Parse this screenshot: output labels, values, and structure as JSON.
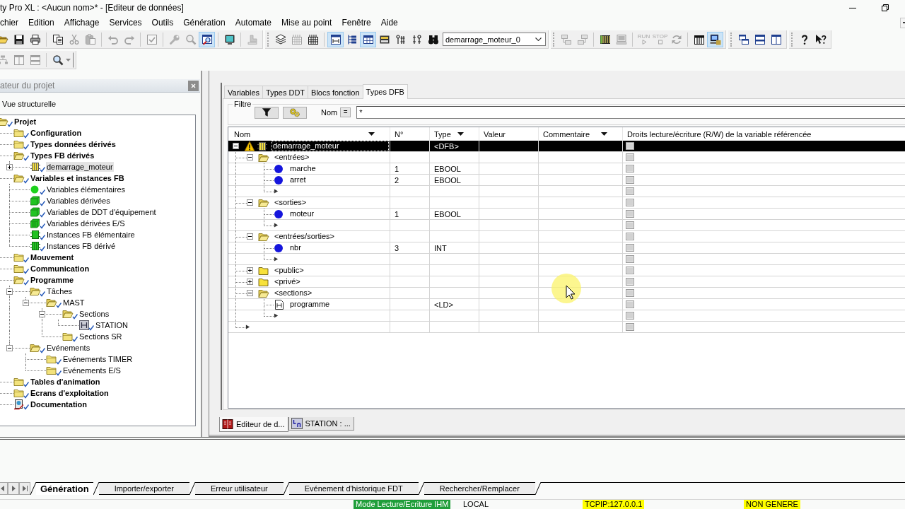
{
  "window": {
    "title": "ty Pro XL : <Aucun nom>* - [Editeur de données]"
  },
  "menu": [
    "chier",
    "Edition",
    "Affichage",
    "Services",
    "Outils",
    "Génération",
    "Automate",
    "Mise au point",
    "Fenêtre",
    "Aide"
  ],
  "toolbar_rows": [
    [
      [
        [
          {
            "kind": "open",
            "pressed": false,
            "disabled": false
          },
          {
            "kind": "save",
            "pressed": false,
            "disabled": false
          },
          {
            "kind": "print",
            "pressed": false,
            "disabled": false
          }
        ],
        [
          {
            "kind": "copy",
            "pressed": false,
            "disabled": false
          },
          {
            "kind": "cut",
            "pressed": false,
            "disabled": true
          },
          {
            "kind": "paste",
            "pressed": false,
            "disabled": true
          }
        ],
        [
          {
            "kind": "undo",
            "pressed": false,
            "disabled": true
          },
          {
            "kind": "redo",
            "pressed": false,
            "disabled": true
          }
        ],
        [
          {
            "kind": "validate",
            "pressed": false,
            "disabled": true
          }
        ],
        [
          {
            "kind": "wrench",
            "pressed": false,
            "disabled": true
          },
          {
            "kind": "find",
            "pressed": false,
            "disabled": true
          },
          {
            "kind": "inspect",
            "pressed": true,
            "disabled": false
          }
        ],
        [
          {
            "kind": "screen",
            "pressed": false,
            "disabled": false
          }
        ],
        [
          {
            "kind": "stamp",
            "pressed": false,
            "disabled": true
          }
        ]
      ],
      [
        [
          {
            "kind": "stack",
            "pressed": false,
            "disabled": false
          },
          {
            "kind": "grid",
            "pressed": false,
            "disabled": true
          },
          {
            "kind": "build",
            "pressed": false,
            "disabled": false
          }
        ],
        [
          {
            "kind": "ladder",
            "pressed": true,
            "disabled": false
          },
          {
            "kind": "tree",
            "pressed": false,
            "disabled": false
          },
          {
            "kind": "table",
            "pressed": true,
            "disabled": false
          },
          {
            "kind": "cabinet",
            "pressed": false,
            "disabled": false
          },
          {
            "kind": "symbol",
            "pressed": false,
            "disabled": false
          },
          {
            "kind": "symbol2",
            "pressed": false,
            "disabled": false
          },
          {
            "kind": "binoculars",
            "pressed": false,
            "disabled": false
          },
          {
            "kind": "combo",
            "value": "demarrage_moteur_0"
          }
        ]
      ],
      [
        [
          {
            "kind": "upload",
            "pressed": false,
            "disabled": true
          },
          {
            "kind": "download",
            "pressed": false,
            "disabled": true
          }
        ],
        [
          {
            "kind": "rack",
            "pressed": false,
            "disabled": false
          },
          {
            "kind": "computer",
            "pressed": false,
            "disabled": true
          }
        ],
        [
          {
            "kind": "run",
            "label": "RUN",
            "pressed": false,
            "disabled": true
          },
          {
            "kind": "stop",
            "label": "STOP",
            "pressed": false,
            "disabled": true
          },
          {
            "kind": "refresh",
            "pressed": false,
            "disabled": true
          }
        ],
        [
          {
            "kind": "rack2",
            "pressed": false,
            "disabled": false
          },
          {
            "kind": "network",
            "pressed": true,
            "disabled": false
          }
        ]
      ],
      [
        [
          {
            "kind": "cascade",
            "pressed": false,
            "disabled": false
          },
          {
            "kind": "rows",
            "pressed": false,
            "disabled": false
          },
          {
            "kind": "columns",
            "pressed": false,
            "disabled": false
          }
        ]
      ],
      [
        [
          {
            "kind": "help",
            "pressed": false,
            "disabled": false
          },
          {
            "kind": "helppointer",
            "pressed": false,
            "disabled": false
          }
        ]
      ]
    ],
    [
      [
        [
          {
            "kind": "hierarchy",
            "pressed": false,
            "disabled": true
          },
          {
            "kind": "columns",
            "pressed": false,
            "disabled": true
          },
          {
            "kind": "rows",
            "pressed": false,
            "disabled": true
          }
        ],
        [
          {
            "kind": "zoom",
            "pressed": false,
            "disabled": false
          }
        ]
      ]
    ]
  ],
  "project_browser": {
    "title": "ateur du projet",
    "view": "Vue structurelle",
    "tree": [
      {
        "label": "Projet",
        "kind": "folder",
        "expanded": true,
        "selected": false,
        "children": [
          {
            "label": "Configuration",
            "kind": "folder",
            "expanded": false,
            "selected": false
          },
          {
            "label": "Types données dérivés",
            "kind": "folder",
            "expanded": false,
            "selected": false
          },
          {
            "label": "Types FB dérivés",
            "kind": "folder",
            "expanded": true,
            "selected": false,
            "children": [
              {
                "label": "demarrage_moteur",
                "kind": "dfb",
                "expanded": false,
                "selected": true
              }
            ]
          },
          {
            "label": "Variables et instances FB",
            "kind": "folder",
            "expanded": true,
            "selected": false,
            "children": [
              {
                "label": "Variables élémentaires",
                "kind": "elementary",
                "selected": false
              },
              {
                "label": "Variables dérivées",
                "kind": "derived",
                "selected": false
              },
              {
                "label": "Variables de DDT d'équipement",
                "kind": "ddt",
                "selected": false
              },
              {
                "label": "Variables dérivées E/S",
                "kind": "io",
                "selected": false
              },
              {
                "label": "Instances FB élémentaire",
                "kind": "fb",
                "selected": false
              },
              {
                "label": "Instances FB dérivé",
                "kind": "dfbinstance",
                "selected": false
              }
            ]
          },
          {
            "label": "Mouvement",
            "kind": "folder",
            "expanded": false,
            "selected": false
          },
          {
            "label": "Communication",
            "kind": "folder",
            "expanded": false,
            "selected": false
          },
          {
            "label": "Programme",
            "kind": "folder",
            "expanded": true,
            "selected": false,
            "children": [
              {
                "label": "Tâches",
                "kind": "folder",
                "expanded": true,
                "selected": false,
                "children": [
                  {
                    "label": "MAST",
                    "kind": "folder",
                    "expanded": true,
                    "selected": false,
                    "children": [
                      {
                        "label": "Sections",
                        "kind": "folder",
                        "expanded": true,
                        "selected": false,
                        "children": [
                          {
                            "label": "STATION",
                            "kind": "section",
                            "selected": false
                          }
                        ]
                      },
                      {
                        "label": "Sections SR",
                        "kind": "folder",
                        "selected": false
                      }
                    ]
                  }
                ]
              },
              {
                "label": "Evénements",
                "kind": "folder",
                "expanded": true,
                "selected": false,
                "children": [
                  {
                    "label": "Evénements TIMER",
                    "kind": "folder",
                    "selected": false
                  },
                  {
                    "label": "Evénements E/S",
                    "kind": "folder",
                    "selected": false
                  }
                ]
              }
            ]
          },
          {
            "label": "Tables d'animation",
            "kind": "folder",
            "expanded": false,
            "selected": false
          },
          {
            "label": "Ecrans d'exploitation",
            "kind": "folder",
            "expanded": false,
            "selected": false
          },
          {
            "label": "Documentation",
            "kind": "documentation",
            "selected": false
          }
        ]
      }
    ]
  },
  "editor": {
    "tabs": [
      {
        "label": "Variables",
        "selected": false
      },
      {
        "label": "Types DDT",
        "selected": false
      },
      {
        "label": "Blocs fonction",
        "selected": false
      },
      {
        "label": "Types DFB",
        "selected": true
      }
    ],
    "filter": {
      "legend": "Filtre",
      "name_label": "Nom",
      "operator": "=",
      "value": "*"
    },
    "table": {
      "columns": [
        {
          "label": "Nom",
          "menu": true
        },
        {
          "label": "N°",
          "menu": false
        },
        {
          "label": "Type",
          "menu": true
        },
        {
          "label": "Valeur",
          "menu": false
        },
        {
          "label": "Commentaire",
          "menu": true
        },
        {
          "label": "Droits lecture/écriture (R/W) de la variable référencée",
          "menu": false
        }
      ],
      "rows": [
        {
          "kind": "dfb",
          "name": "demarrage_moteur",
          "type": "<DFB>",
          "warning": true,
          "expanded": true,
          "selected": true,
          "checked": false,
          "children": [
            {
              "kind": "group",
              "name": "<entrées>",
              "expanded": true,
              "selected": false,
              "checked": false,
              "children": [
                {
                  "kind": "var",
                  "name": "marche",
                  "number": "1",
                  "type": "EBOOL",
                  "selected": false,
                  "checked": false
                },
                {
                  "kind": "var",
                  "name": "arret",
                  "number": "2",
                  "type": "EBOOL",
                  "selected": false,
                  "checked": false
                },
                {
                  "kind": "new",
                  "selected": false,
                  "checked": false
                }
              ]
            },
            {
              "kind": "group",
              "name": "<sorties>",
              "expanded": true,
              "selected": false,
              "checked": false,
              "children": [
                {
                  "kind": "var",
                  "name": "moteur",
                  "number": "1",
                  "type": "EBOOL",
                  "selected": false,
                  "checked": false
                },
                {
                  "kind": "new",
                  "selected": false,
                  "checked": false
                }
              ]
            },
            {
              "kind": "group",
              "name": "<entrées/sorties>",
              "expanded": true,
              "selected": false,
              "checked": false,
              "children": [
                {
                  "kind": "var",
                  "name": "nbr",
                  "number": "3",
                  "type": "INT",
                  "selected": false,
                  "checked": false
                },
                {
                  "kind": "new",
                  "selected": false,
                  "checked": false
                }
              ]
            },
            {
              "kind": "group",
              "name": "<public>",
              "expanded": false,
              "selected": false,
              "checked": false
            },
            {
              "kind": "group",
              "name": "<privé>",
              "expanded": false,
              "selected": false,
              "checked": false
            },
            {
              "kind": "group",
              "name": "<sections>",
              "expanded": true,
              "selected": false,
              "checked": false,
              "children": [
                {
                  "kind": "section",
                  "name": "programme",
                  "type": "<LD>",
                  "selected": false,
                  "checked": false
                },
                {
                  "kind": "new",
                  "selected": false,
                  "checked": false
                }
              ]
            },
            {
              "kind": "new",
              "selected": false,
              "checked": false
            }
          ]
        }
      ]
    },
    "documents": [
      {
        "label": "Editeur de d...",
        "kind": "editor",
        "selected": true
      },
      {
        "label": "STATION : ...",
        "kind": "section",
        "selected": false
      }
    ]
  },
  "output_tabs": [
    {
      "label": "Génération",
      "selected": true
    },
    {
      "label": "Importer/exporter",
      "selected": false
    },
    {
      "label": "Erreur utilisateur",
      "selected": false
    },
    {
      "label": "Evénement d'historique FDT",
      "selected": false
    },
    {
      "label": "Rechercher/Remplacer",
      "selected": false
    }
  ],
  "status_bar": [
    {
      "text": "Mode Lecture/Ecriture IHM",
      "color": "#1f9e3a"
    },
    {
      "text": "LOCAL"
    },
    {
      "text": "TCPIP:127.0.0.1",
      "color": "#ffff00"
    },
    {
      "text": "NON GENERE",
      "color": "#ffff00"
    }
  ]
}
